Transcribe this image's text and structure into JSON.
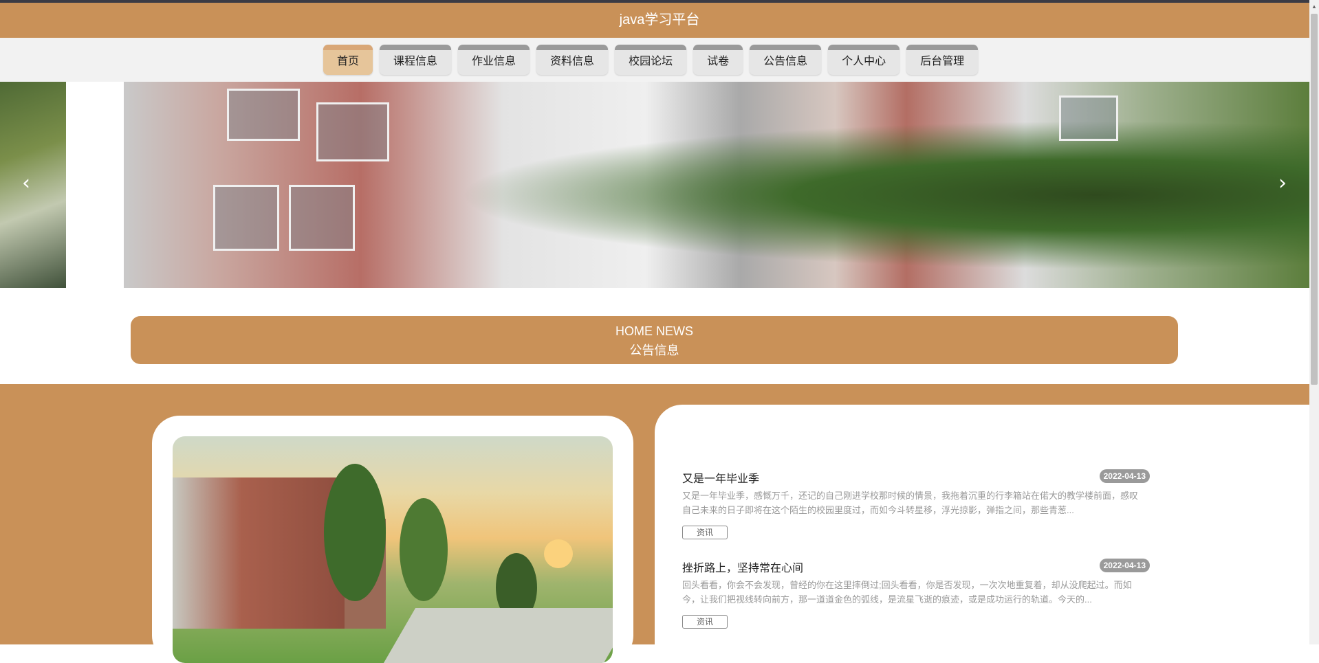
{
  "header": {
    "title": "java学习平台"
  },
  "nav": {
    "items": [
      {
        "label": "首页",
        "active": true
      },
      {
        "label": "课程信息"
      },
      {
        "label": "作业信息"
      },
      {
        "label": "资料信息"
      },
      {
        "label": "校园论坛"
      },
      {
        "label": "试卷"
      },
      {
        "label": "公告信息"
      },
      {
        "label": "个人中心"
      },
      {
        "label": "后台管理"
      }
    ]
  },
  "banner": {
    "prev_icon": "chevron-left-icon",
    "next_icon": "chevron-right-icon"
  },
  "news_section": {
    "title_en": "HOME NEWS",
    "title_zh": "公告信息"
  },
  "news": [
    {
      "title": "又是一年毕业季",
      "date": "2022-04-13",
      "desc": "又是一年毕业季，感慨万千，还记的自己刚进学校那时候的情景，我拖着沉重的行李箱站在偌大的教学楼前面，感叹自己未来的日子即将在这个陌生的校园里度过，而如今斗转星移，浮光掠影，弹指之间，那些青葱...",
      "tag": "资讯"
    },
    {
      "title": "挫折路上，坚持常在心间",
      "date": "2022-04-13",
      "desc": "回头看看，你会不会发现，曾经的你在这里摔倒过;回头看看，你是否发现，一次次地重复着，却从没爬起过。而如今，让我们把视线转向前方，那一道道金色的弧线，是流星飞逝的痕迹，或是成功运行的轨道。今天的...",
      "tag": "资讯"
    }
  ],
  "colors": {
    "accent": "#c99158",
    "active_nav": "#e6c59a",
    "date_badge": "#9a9a9a"
  }
}
